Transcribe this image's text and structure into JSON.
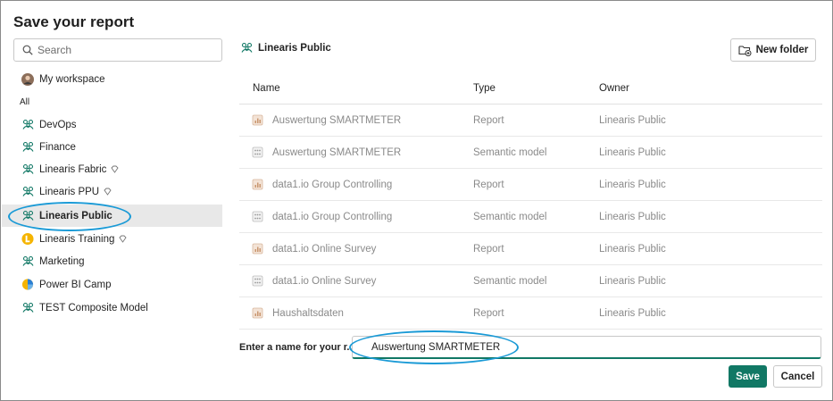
{
  "dialog": {
    "title": "Save your report"
  },
  "search": {
    "placeholder": "Search",
    "icon": "search-icon"
  },
  "sidebar": {
    "my_workspace": {
      "label": "My workspace",
      "icon": "avatar"
    },
    "all_label": "All",
    "items": [
      {
        "label": "DevOps",
        "icon": "workspace-icon",
        "badge": ""
      },
      {
        "label": "Finance",
        "icon": "workspace-icon",
        "badge": ""
      },
      {
        "label": "Linearis Fabric",
        "icon": "workspace-icon",
        "badge": "diamond-icon"
      },
      {
        "label": "Linearis PPU",
        "icon": "workspace-icon",
        "badge": "diamond-icon"
      },
      {
        "label": "Linearis Public",
        "icon": "workspace-icon",
        "badge": "",
        "selected": true
      },
      {
        "label": "Linearis Training",
        "icon": "linearis-logo-icon",
        "badge": "diamond-icon"
      },
      {
        "label": "Marketing",
        "icon": "workspace-icon",
        "badge": ""
      },
      {
        "label": "Power BI Camp",
        "icon": "powerbi-camp-logo-icon",
        "badge": ""
      },
      {
        "label": "TEST Composite Model",
        "icon": "workspace-icon",
        "badge": ""
      }
    ]
  },
  "main": {
    "current_workspace": "Linearis Public",
    "new_folder_label": "New folder",
    "columns": {
      "name": "Name",
      "type": "Type",
      "owner": "Owner"
    },
    "rows": [
      {
        "name": "Auswertung SMARTMETER",
        "type": "Report",
        "owner": "Linearis Public",
        "icon": "report-icon"
      },
      {
        "name": "Auswertung SMARTMETER",
        "type": "Semantic model",
        "owner": "Linearis Public",
        "icon": "semantic-model-icon"
      },
      {
        "name": "data1.io Group Controlling",
        "type": "Report",
        "owner": "Linearis Public",
        "icon": "report-icon"
      },
      {
        "name": "data1.io Group Controlling",
        "type": "Semantic model",
        "owner": "Linearis Public",
        "icon": "semantic-model-icon"
      },
      {
        "name": "data1.io Online Survey",
        "type": "Report",
        "owner": "Linearis Public",
        "icon": "report-icon"
      },
      {
        "name": "data1.io Online Survey",
        "type": "Semantic model",
        "owner": "Linearis Public",
        "icon": "semantic-model-icon"
      },
      {
        "name": "Haushaltsdaten",
        "type": "Report",
        "owner": "Linearis Public",
        "icon": "report-icon"
      }
    ],
    "name_field": {
      "label": "Enter a name for your r...",
      "value": "Auswertung SMARTMETER"
    },
    "save_label": "Save",
    "cancel_label": "Cancel"
  },
  "colors": {
    "accent": "#117865",
    "annotation": "#1a9ad6",
    "selected_bg": "#e8e8e8"
  }
}
